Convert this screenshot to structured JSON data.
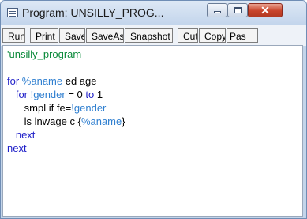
{
  "window": {
    "title": "Program: UNSILLY_PROG...",
    "close_glyph": "✕"
  },
  "toolbar": {
    "buttons": [
      "Run",
      "Print",
      "Save",
      "SaveAs",
      "Snapshot",
      "Cut",
      "Copy",
      "Pas"
    ]
  },
  "editor": {
    "lines": [
      [
        {
          "t": "'unsilly_program",
          "k": "comment"
        }
      ],
      [],
      [
        {
          "t": "for ",
          "k": "kw"
        },
        {
          "t": "%aname",
          "k": "var"
        },
        {
          "t": " ed age",
          "k": "plain"
        }
      ],
      [
        {
          "t": "   for ",
          "k": "kw"
        },
        {
          "t": "!gender",
          "k": "var"
        },
        {
          "t": " = 0 ",
          "k": "plain"
        },
        {
          "t": "to",
          "k": "kw"
        },
        {
          "t": " 1",
          "k": "plain"
        }
      ],
      [
        {
          "t": "      smpl if fe=",
          "k": "plain"
        },
        {
          "t": "!gender",
          "k": "var"
        }
      ],
      [
        {
          "t": "      ls lnwage c {",
          "k": "plain"
        },
        {
          "t": "%aname",
          "k": "var"
        },
        {
          "t": "}",
          "k": "plain"
        }
      ],
      [
        {
          "t": "   next",
          "k": "kw"
        }
      ],
      [
        {
          "t": "next",
          "k": "kw"
        }
      ]
    ]
  }
}
